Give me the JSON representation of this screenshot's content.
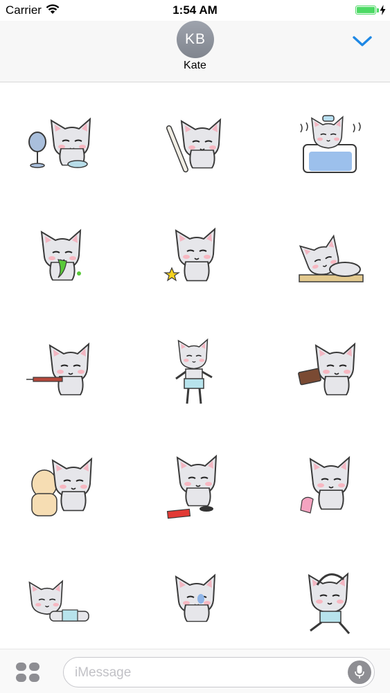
{
  "status_bar": {
    "carrier": "Carrier",
    "time": "1:54 AM",
    "battery_level": 1.0,
    "battery_color": "#4cd964",
    "charging": true
  },
  "header": {
    "avatar_initials": "KB",
    "contact_name": "Kate",
    "done_icon": "chevron-down-icon",
    "accent_color": "#1e88e5"
  },
  "stickers": [
    {
      "id": "sticker-cat-with-fan",
      "description_icon": "cat-fan"
    },
    {
      "id": "sticker-cat-with-bone",
      "description_icon": "cat-bone"
    },
    {
      "id": "sticker-cat-sick-in-bed",
      "description_icon": "cat-bed"
    },
    {
      "id": "sticker-cat-vomiting",
      "description_icon": "cat-vomit"
    },
    {
      "id": "sticker-cat-with-star",
      "description_icon": "cat-star"
    },
    {
      "id": "sticker-cat-sleeping-on-table",
      "description_icon": "cat-sleep"
    },
    {
      "id": "sticker-cat-with-syringe",
      "description_icon": "cat-syringe"
    },
    {
      "id": "sticker-cat-in-underwear",
      "description_icon": "cat-underwear"
    },
    {
      "id": "sticker-cat-with-wallet",
      "description_icon": "cat-wallet"
    },
    {
      "id": "sticker-cat-hugging-friend",
      "description_icon": "cat-hug"
    },
    {
      "id": "sticker-cat-with-red-envelope",
      "description_icon": "cat-envelope"
    },
    {
      "id": "sticker-cat-with-pink-cloth",
      "description_icon": "cat-cloth"
    },
    {
      "id": "sticker-cat-lying-down",
      "description_icon": "cat-lying"
    },
    {
      "id": "sticker-cat-scared",
      "description_icon": "cat-scared"
    },
    {
      "id": "sticker-cat-stretching",
      "description_icon": "cat-stretch"
    }
  ],
  "input": {
    "placeholder": "iMessage",
    "apps_icon": "app-drawer-icon",
    "mic_icon": "microphone-icon"
  }
}
